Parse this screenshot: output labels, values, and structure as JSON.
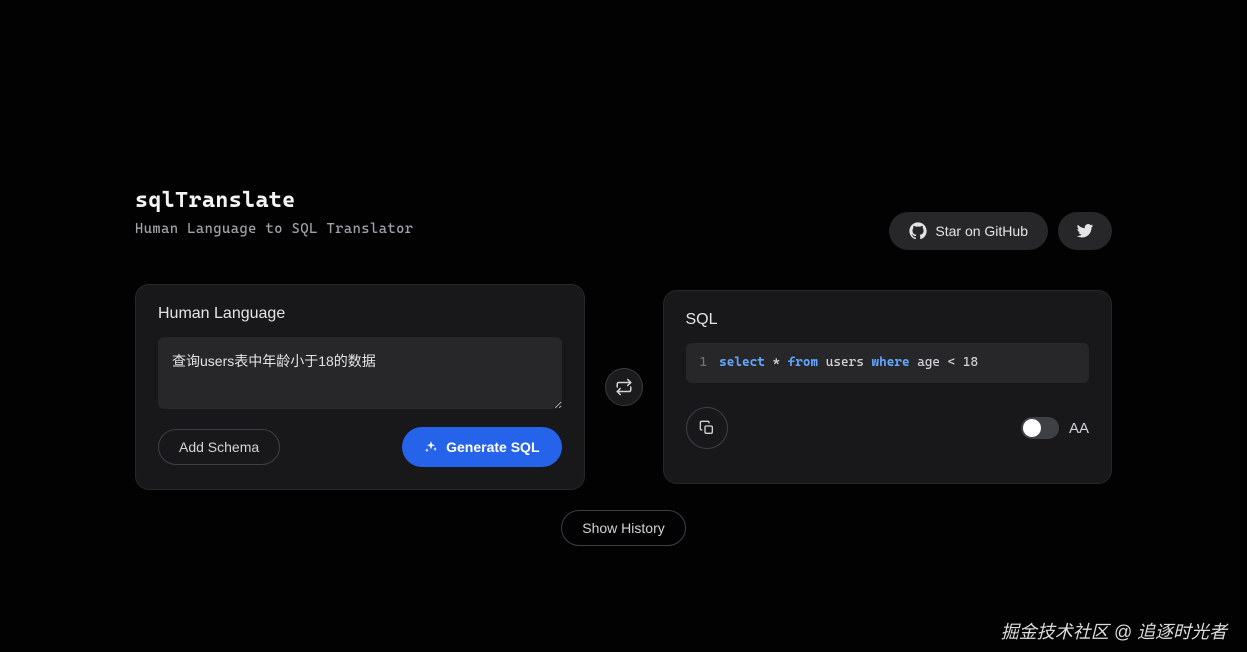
{
  "header": {
    "title": "sqlTranslate",
    "subtitle": "Human Language to SQL Translator",
    "github_label": "Star on GitHub"
  },
  "input_panel": {
    "title": "Human Language",
    "value": "查询users表中年龄小于18的数据",
    "add_schema_label": "Add Schema",
    "generate_label": "Generate SQL"
  },
  "output_panel": {
    "title": "SQL",
    "line_number": "1",
    "sql": {
      "k1": "select",
      "star": " * ",
      "k2": "from",
      "tbl": " users ",
      "k3": "where",
      "rest": " age < 18"
    },
    "aa_label": "AA"
  },
  "footer": {
    "show_history_label": "Show History"
  },
  "watermark": "掘金技术社区 @ 追逐时光者"
}
